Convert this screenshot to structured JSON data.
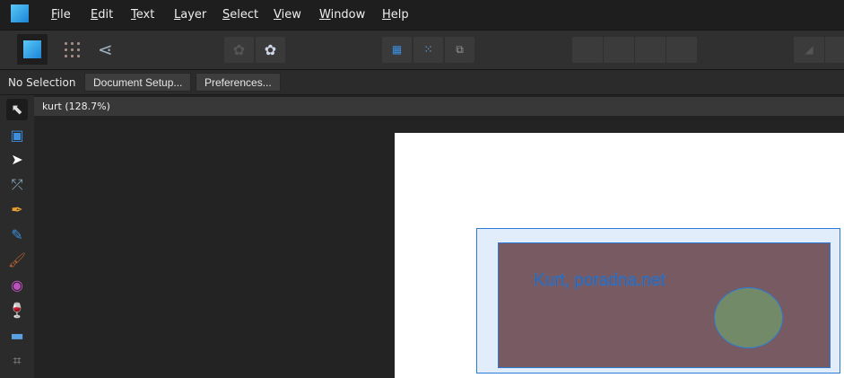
{
  "app": {
    "name": "Affinity Designer",
    "accent": "#2fa0e6"
  },
  "menu": [
    "File",
    "Edit",
    "Text",
    "Layer",
    "Select",
    "View",
    "Window",
    "Help"
  ],
  "toolbar": {
    "personas": [
      "designer-persona-icon",
      "pixel-persona-icon",
      "export-persona-icon"
    ]
  },
  "context": {
    "status": "No Selection",
    "document_setup": "Document Setup...",
    "preferences": "Preferences..."
  },
  "document": {
    "tab": "kurt (128.7%)",
    "text": "Kurt, poradna.net",
    "colors": {
      "rect": "#775a62",
      "ellipse": "#728a68",
      "selection": "#2b7bd8"
    }
  },
  "tools": [
    "move-tool-icon",
    "artboard-tool-icon",
    "node-tool-icon",
    "corner-tool-icon",
    "pen-tool-icon",
    "pencil-tool-icon",
    "vector-brush-icon",
    "fill-tool-icon",
    "transparency-tool-icon",
    "place-image-icon",
    "crop-tool-icon"
  ]
}
